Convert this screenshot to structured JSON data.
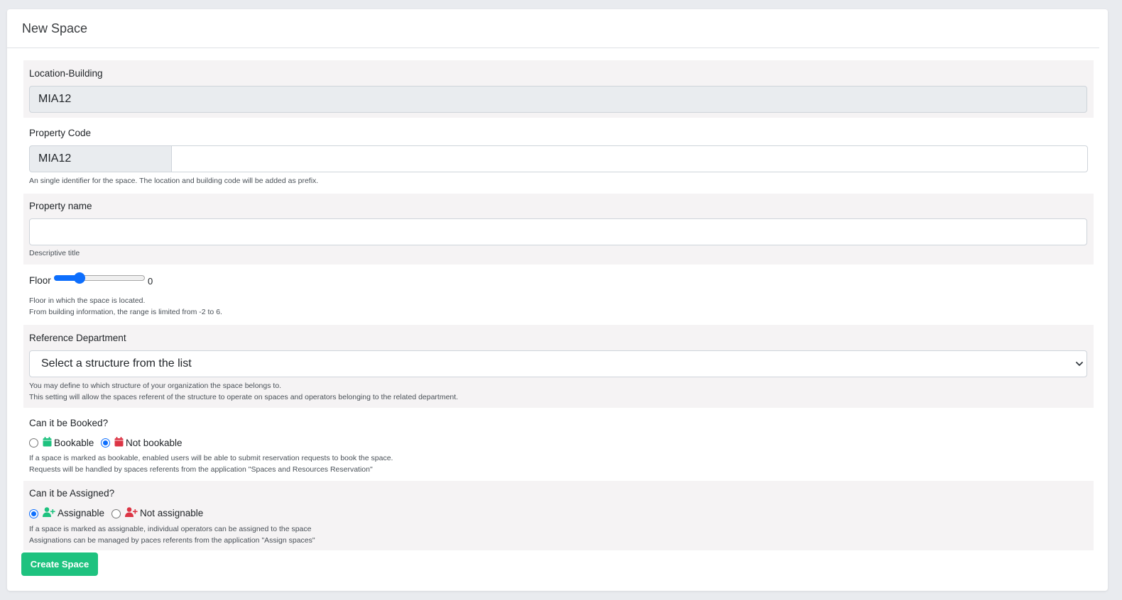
{
  "header": {
    "title": "New Space"
  },
  "location_building": {
    "label": "Location-Building",
    "value": "MIA12"
  },
  "property_code": {
    "label": "Property Code",
    "prefix": "MIA12",
    "value": "",
    "help": "An single identifier for the space. The location and building code will be added as prefix."
  },
  "property_name": {
    "label": "Property name",
    "value": "",
    "help": "Descriptive title"
  },
  "floor": {
    "label": "Floor",
    "value": "0",
    "min": -2,
    "max": 6,
    "help_line1": "Floor in which the space is located.",
    "help_line2": "From building information, the range is limited from -2 to 6."
  },
  "reference_department": {
    "label": "Reference Department",
    "selected": "Select a structure from the list",
    "help_line1": "You may define to which structure of your organization the space belongs to.",
    "help_line2": "This setting will allow the spaces referent of the structure to operate on spaces and operators belonging to the related department."
  },
  "booking": {
    "label": "Can it be Booked?",
    "options": [
      {
        "label": "Bookable",
        "checked": false,
        "icon": "calendar-icon",
        "color": "#1ec27f"
      },
      {
        "label": "Not bookable",
        "checked": true,
        "icon": "calendar-icon",
        "color": "#dc3545"
      }
    ],
    "help_line1": "If a space is marked as bookable, enabled users will be able to submit reservation requests to book the space.",
    "help_line2": "Requests will be handled by spaces referents from the application \"Spaces and Resources Reservation\""
  },
  "assignment": {
    "label": "Can it be Assigned?",
    "options": [
      {
        "label": "Assignable",
        "checked": true,
        "icon": "user-plus-icon",
        "color": "#1ec27f"
      },
      {
        "label": "Not assignable",
        "checked": false,
        "icon": "user-plus-icon",
        "color": "#dc3545"
      }
    ],
    "help_line1": "If a space is marked as assignable, individual operators can be assigned to the space",
    "help_line2": "Assignations can be managed by paces referents from the application \"Assign spaces\""
  },
  "submit": {
    "label": "Create Space"
  },
  "colors": {
    "accent": "#0d6efd",
    "success": "#1ec27f",
    "danger": "#dc3545"
  }
}
